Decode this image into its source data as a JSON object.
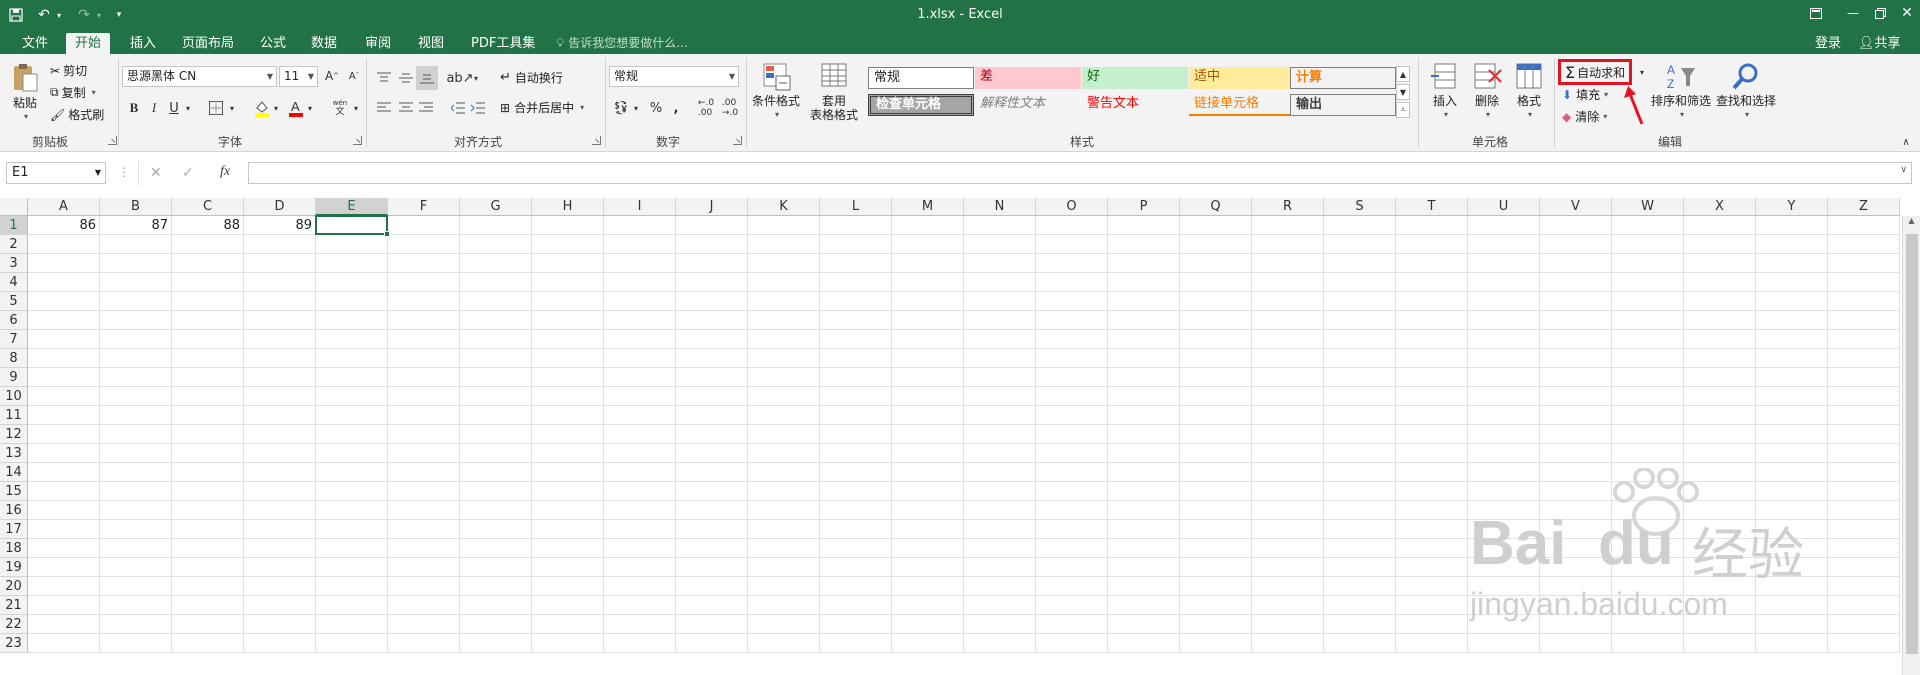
{
  "title_bar": {
    "title": "1.xlsx - Excel",
    "save_icon": "save-icon",
    "undo_icon": "undo-icon",
    "redo_icon": "redo-icon",
    "customize_icon": "customize-qat-icon"
  },
  "tabs": [
    "文件",
    "开始",
    "插入",
    "页面布局",
    "公式",
    "数据",
    "审阅",
    "视图",
    "PDF工具集"
  ],
  "active_tab": "开始",
  "tell_me": "告诉我您想要做什么...",
  "signin": "登录",
  "share": "共享",
  "ribbon": {
    "clipboard": {
      "paste": "粘贴",
      "cut": "剪切",
      "copy": "复制",
      "format_painter": "格式刷",
      "label": "剪贴板"
    },
    "font": {
      "name": "思源黑体 CN",
      "size": "11",
      "label": "字体"
    },
    "alignment": {
      "wrap": "自动换行",
      "merge": "合并后居中",
      "label": "对齐方式"
    },
    "number": {
      "format": "常规",
      "label": "数字"
    },
    "styles": {
      "cond_format": "条件格式",
      "table_format": "套用\n表格格式",
      "cells": [
        {
          "text": "常规",
          "bg": "#ffffff",
          "color": "#222222"
        },
        {
          "text": "差",
          "bg": "#ffc7ce",
          "color": "#9c0006"
        },
        {
          "text": "好",
          "bg": "#c6efce",
          "color": "#006100"
        },
        {
          "text": "适中",
          "bg": "#ffeb9c",
          "color": "#9c5700"
        },
        {
          "text": "计算",
          "bg": "#f2f2f2",
          "color": "#fa7d00"
        },
        {
          "text": "检查单元格",
          "bg": "#a5a5a5",
          "color": "#ffffff"
        },
        {
          "text": "解释性文本",
          "bg": "#f3f3f3",
          "color": "#7f7f7f"
        },
        {
          "text": "警告文本",
          "bg": "#f3f3f3",
          "color": "#ff0000"
        },
        {
          "text": "链接单元格",
          "bg": "#f3f3f3",
          "color": "#fa7d00"
        },
        {
          "text": "输出",
          "bg": "#f2f2f2",
          "color": "#3f3f3f"
        }
      ],
      "label": "样式"
    },
    "cells_group": {
      "insert": "插入",
      "delete": "删除",
      "format": "格式",
      "label": "单元格"
    },
    "editing": {
      "autosum": "自动求和",
      "fill": "填充",
      "clear": "清除",
      "sort": "排序和筛选",
      "find": "查找和选择",
      "label": "编辑"
    }
  },
  "formula_bar": {
    "name_box": "E1",
    "fx": "fx",
    "formula": ""
  },
  "columns": [
    "A",
    "B",
    "C",
    "D",
    "E",
    "F",
    "G",
    "H",
    "I",
    "J",
    "K",
    "L",
    "M",
    "N",
    "O",
    "P",
    "Q",
    "R",
    "S",
    "T",
    "U",
    "V",
    "W",
    "X",
    "Y",
    "Z"
  ],
  "rows": [
    "1",
    "2",
    "3",
    "4",
    "5",
    "6",
    "7",
    "8",
    "9",
    "10",
    "11",
    "12",
    "13",
    "14",
    "15",
    "16",
    "17",
    "18",
    "19",
    "20",
    "21",
    "22",
    "23"
  ],
  "cells": [
    {
      "ref": "A1",
      "value": "86"
    },
    {
      "ref": "B1",
      "value": "87"
    },
    {
      "ref": "C1",
      "value": "88"
    },
    {
      "ref": "D1",
      "value": "89"
    }
  ],
  "selected_cell": "E1",
  "watermark": {
    "brand": "Bai",
    "du": "du",
    "cn": "经验",
    "url": "jingyan.baidu.com"
  },
  "colors": {
    "accent": "#217346",
    "highlight": "#e81123"
  }
}
